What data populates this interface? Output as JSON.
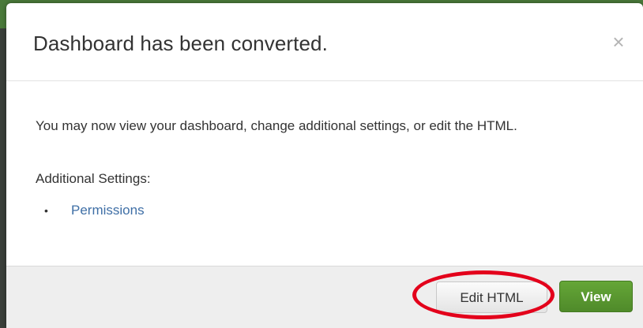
{
  "dialog": {
    "title": "Dashboard has been converted.",
    "close_symbol": "×",
    "body_text": "You may now view your dashboard, change additional settings, or edit the HTML.",
    "settings_label": "Additional Settings:",
    "settings_items": [
      {
        "bullet": "•",
        "label": "Permissions"
      }
    ],
    "buttons": {
      "edit_html": "Edit HTML",
      "view": "View"
    }
  },
  "colors": {
    "link": "#3f6fa6",
    "primary_button": "#5a9a32",
    "annotation": "#e3001b",
    "title_text": "#333333"
  },
  "icons": {
    "close": "close-icon"
  }
}
